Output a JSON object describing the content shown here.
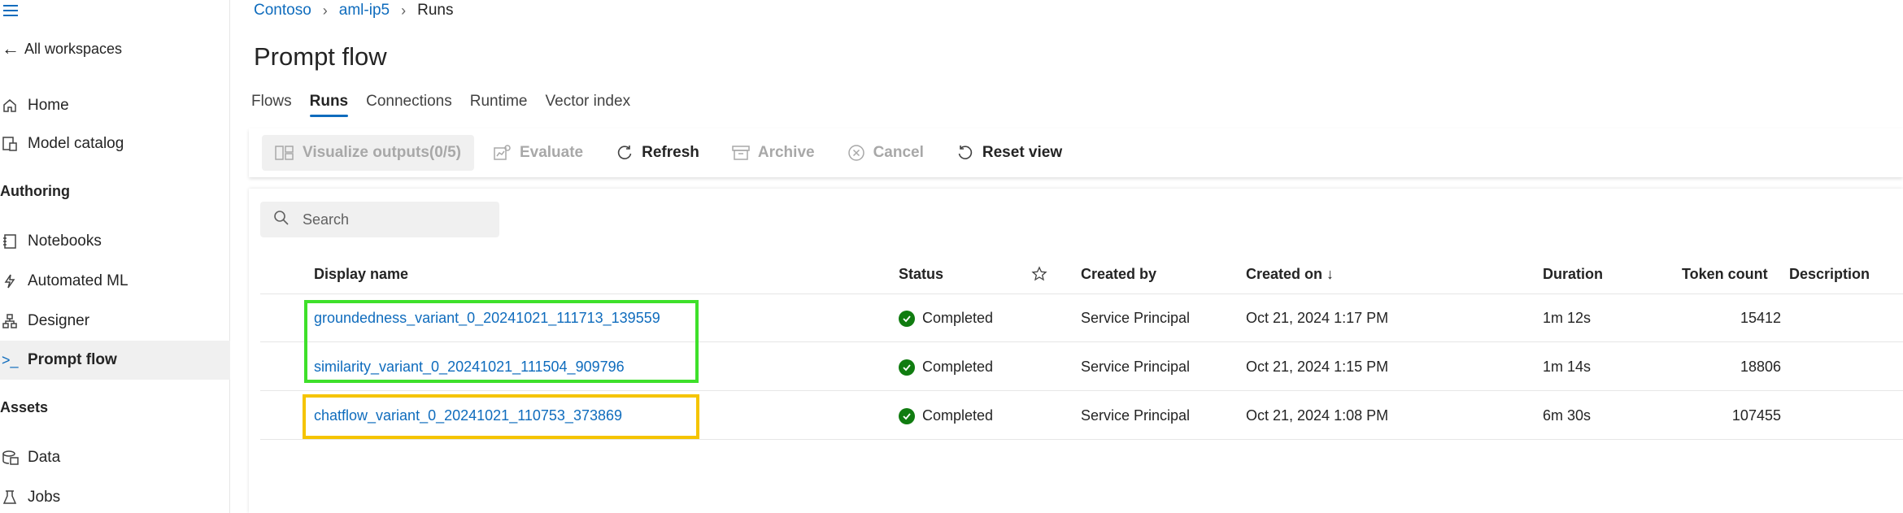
{
  "sidebar": {
    "back_label": "All workspaces",
    "items_top": [
      {
        "label": "Home",
        "icon": "home-icon"
      },
      {
        "label": "Model catalog",
        "icon": "model-catalog-icon"
      }
    ],
    "authoring_heading": "Authoring",
    "authoring_items": [
      {
        "label": "Notebooks",
        "icon": "notebook-icon"
      },
      {
        "label": "Automated ML",
        "icon": "automated-ml-icon"
      },
      {
        "label": "Designer",
        "icon": "designer-icon"
      },
      {
        "label": "Prompt flow",
        "icon": "prompt-flow-icon"
      }
    ],
    "assets_heading": "Assets",
    "assets_items": [
      {
        "label": "Data",
        "icon": "data-icon"
      },
      {
        "label": "Jobs",
        "icon": "jobs-icon"
      }
    ],
    "active_item": "Prompt flow"
  },
  "breadcrumb": [
    "Contoso",
    "aml-ip5",
    "Runs"
  ],
  "page_title": "Prompt flow",
  "tabs": [
    "Flows",
    "Runs",
    "Connections",
    "Runtime",
    "Vector index"
  ],
  "active_tab": "Runs",
  "toolbar": {
    "visualize": "Visualize outputs(0/5)",
    "evaluate": "Evaluate",
    "refresh": "Refresh",
    "archive": "Archive",
    "cancel": "Cancel",
    "reset": "Reset view"
  },
  "search": {
    "placeholder": "Search"
  },
  "table": {
    "headers": {
      "display_name": "Display name",
      "status": "Status",
      "created_by": "Created by",
      "created_on": "Created on ↓",
      "duration": "Duration",
      "token_count": "Token count",
      "description": "Description"
    },
    "rows": [
      {
        "display_name": "groundedness_variant_0_20241021_111713_139559",
        "status": "Completed",
        "created_by": "Service Principal",
        "created_on": "Oct 21, 2024 1:17 PM",
        "duration": "1m 12s",
        "token_count": "15412",
        "description": ""
      },
      {
        "display_name": "similarity_variant_0_20241021_111504_909796",
        "status": "Completed",
        "created_by": "Service Principal",
        "created_on": "Oct 21, 2024 1:15 PM",
        "duration": "1m 14s",
        "token_count": "18806",
        "description": ""
      },
      {
        "display_name": "chatflow_variant_0_20241021_110753_373869",
        "status": "Completed",
        "created_by": "Service Principal",
        "created_on": "Oct 21, 2024 1:08 PM",
        "duration": "6m 30s",
        "token_count": "107455",
        "description": ""
      }
    ]
  },
  "colors": {
    "accent": "#0f6cbd",
    "success": "#107c10",
    "highlight_green": "#3ee02a",
    "highlight_yellow": "#f5c400"
  }
}
